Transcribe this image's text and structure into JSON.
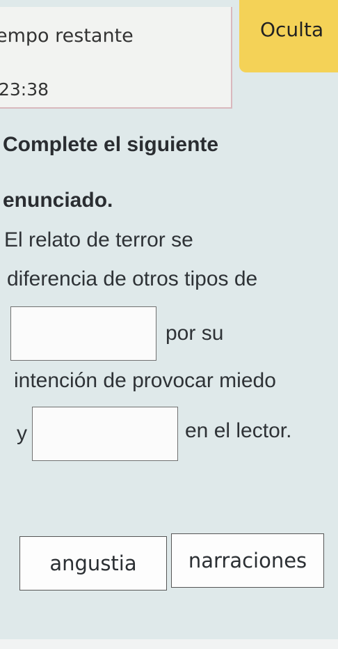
{
  "timer": {
    "label": "empo restante",
    "value": "23:38"
  },
  "hide_button": {
    "label": "Oculta"
  },
  "question": {
    "instruction": "Complete el siguiente enunciado.",
    "line1": "El relato de terror se",
    "line2": "diferencia de otros tipos de",
    "after_blank1": "por su",
    "line4": "intención de provocar miedo",
    "before_blank2": "y",
    "after_blank2": "en el lector."
  },
  "options": [
    {
      "label": "angustia"
    },
    {
      "label": "narraciones"
    }
  ]
}
